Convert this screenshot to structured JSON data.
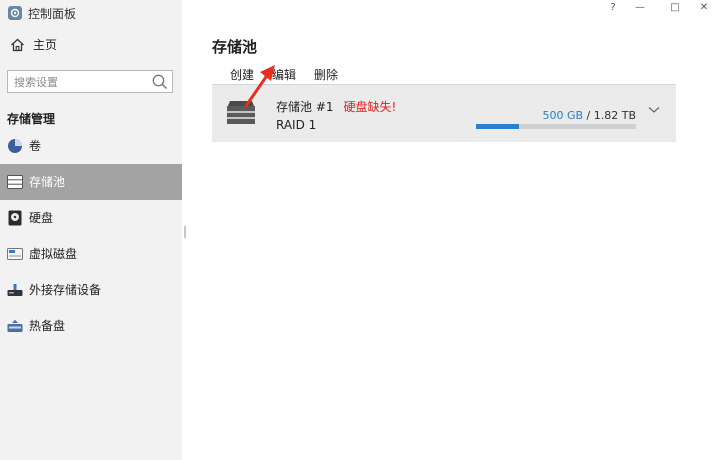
{
  "window": {
    "title": "控制面板",
    "controls": {
      "help": "?",
      "minimize": "—",
      "maximize": "□",
      "close": "✕"
    }
  },
  "sidebar": {
    "home_label": "主页",
    "search": {
      "placeholder": "搜索设置",
      "value": ""
    },
    "section_title": "存储管理",
    "items": [
      {
        "label": "卷",
        "icon": "volume-pie-icon",
        "active": false
      },
      {
        "label": "存储池",
        "icon": "storage-pool-icon",
        "active": true
      },
      {
        "label": "硬盘",
        "icon": "hdd-icon",
        "active": false
      },
      {
        "label": "虚拟磁盘",
        "icon": "virtual-disk-icon",
        "active": false
      },
      {
        "label": "外接存储设备",
        "icon": "external-storage-icon",
        "active": false
      },
      {
        "label": "热备盘",
        "icon": "hot-spare-icon",
        "active": false
      }
    ]
  },
  "main": {
    "title": "存储池",
    "toolbar": {
      "create": "创建",
      "edit": "编辑",
      "delete": "删除"
    },
    "pools": [
      {
        "name": "存储池 #1",
        "warning": "硬盘缺失!",
        "raid": "RAID 1",
        "used": "500 GB",
        "separator": " / ",
        "total": "1.82 TB",
        "usage_fraction": 0.27
      }
    ]
  },
  "colors": {
    "accent": "#2b7fd0",
    "warning": "#e02020",
    "active_nav": "#a3a3a3",
    "arrow": "#e53020"
  }
}
